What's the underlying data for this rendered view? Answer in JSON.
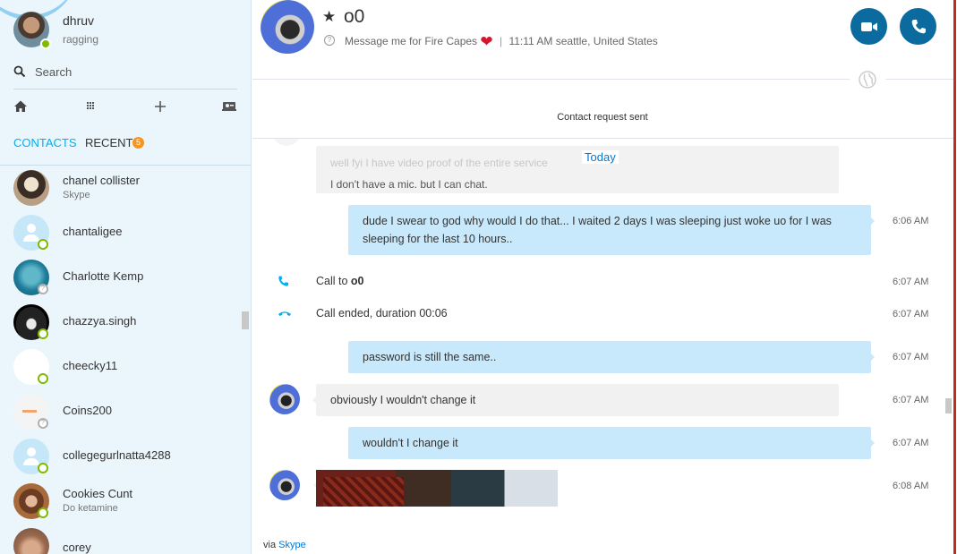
{
  "profile": {
    "name": "dhruv",
    "mood": "ragging"
  },
  "search": {
    "placeholder": "Search"
  },
  "tabs": {
    "contacts": "CONTACTS",
    "recent": "RECENT",
    "recent_badge": "5"
  },
  "contacts": [
    {
      "name": "chanel collister",
      "sub": "Skype",
      "status": "none"
    },
    {
      "name": "chantaligee",
      "sub": "",
      "status": "online"
    },
    {
      "name": "Charlotte Kemp",
      "sub": "",
      "status": "unknown"
    },
    {
      "name": "chazzya.singh",
      "sub": "",
      "status": "online"
    },
    {
      "name": "cheecky11",
      "sub": "",
      "status": "online"
    },
    {
      "name": "Coins200",
      "sub": "",
      "status": "unknown"
    },
    {
      "name": "collegegurlnatta4288",
      "sub": "",
      "status": "online"
    },
    {
      "name": "Cookies Cunt",
      "sub": "Do ketamine",
      "status": "online"
    },
    {
      "name": "corey",
      "sub": "",
      "status": "none"
    }
  ],
  "conversation": {
    "title": "o0",
    "mood": "Message me for Fire Capes",
    "local_time": "11:11 AM seattle, United States",
    "request_notice": "Contact request sent",
    "today_label": "Today",
    "ghost_messages": [
      "well fyi I have video proof of the entire service",
      "I don't have a mic. but I can chat."
    ],
    "messages": [
      {
        "kind": "out",
        "text": "dude I swear to god why would I do that... I waited 2 days I was sleeping just woke uo for I was sleeping for the last 10 hours..",
        "time": "6:06 AM"
      },
      {
        "kind": "system-call",
        "text": "Call to ",
        "bold": "o0",
        "time": "6:07 AM"
      },
      {
        "kind": "system-end",
        "text": "Call ended, duration 00:06",
        "time": "6:07 AM"
      },
      {
        "kind": "out",
        "text": "password is still the same..",
        "time": "6:07 AM"
      },
      {
        "kind": "in",
        "text": "obviously I wouldn't change it",
        "time": "6:07 AM"
      },
      {
        "kind": "out",
        "text": "wouldn't I change it",
        "time": "6:07 AM"
      },
      {
        "kind": "image",
        "text": "",
        "time": "6:08 AM"
      }
    ],
    "via_prefix": "via",
    "via_link": "Skype"
  },
  "colors": {
    "accent": "#00aff0",
    "call_button": "#0b6a9e",
    "outgoing_bubble": "#c7e9fb",
    "incoming_bubble": "#f1f1f1",
    "online": "#7fba00",
    "badge": "#f7941d",
    "heart": "#d5162c"
  },
  "icons": {
    "search": "search-icon",
    "home": "home-icon",
    "dialpad": "dialpad-icon",
    "add": "plus-icon",
    "contact_card": "contact-card-icon",
    "video_call": "video-camera-icon",
    "audio_call": "phone-icon",
    "globe": "globe-icon",
    "heart": "heart-icon",
    "favorite": "star-icon"
  }
}
